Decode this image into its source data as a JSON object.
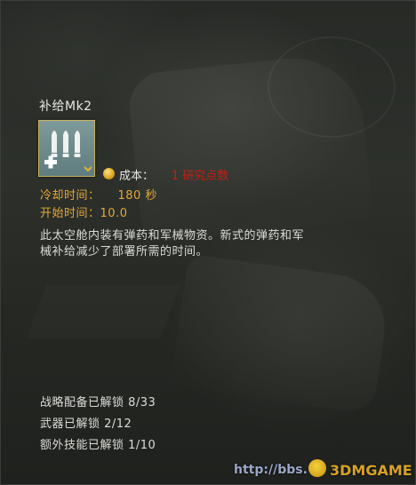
{
  "item": {
    "title": "补给Mk2",
    "icon": "supply-ammo-icon",
    "cost_label": "成本：",
    "cost_value": "1 研究点数",
    "cooldown_label": "冷却时间：",
    "cooldown_value": "180 秒",
    "start_label": "开始时间：",
    "start_value": "10.0",
    "description_line1": "此太空舱内装有弹药和军械物资。新式的弹药和军",
    "description_line2": "械补给减少了部署所需的时间。"
  },
  "unlocks": {
    "stratagems": "战略配备已解锁 8/33",
    "weapons": "武器已解锁 2/12",
    "perks": "额外技能已解锁 1/10"
  },
  "watermark": {
    "url": "http://bbs.",
    "brand": "3DMGAME"
  },
  "colors": {
    "accent": "#e4a83a",
    "cost": "#c41f12",
    "text": "#dcdcd8",
    "icon_bg": "#6f8c8d"
  }
}
